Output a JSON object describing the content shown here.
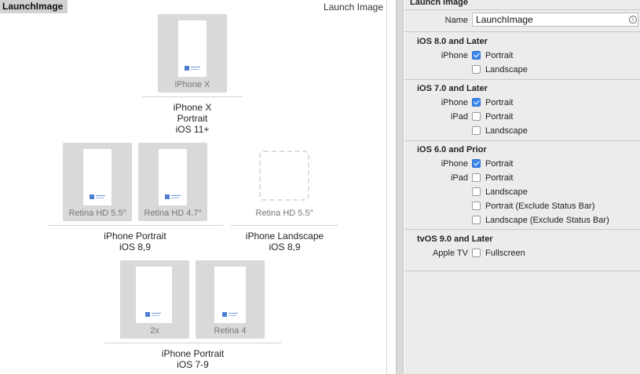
{
  "canvas": {
    "set_name": "LaunchImage",
    "set_type": "Launch Image",
    "groups": [
      {
        "caption": [
          "iPhone X",
          "Portrait",
          "iOS 11+"
        ],
        "slots": [
          {
            "label": "iPhone X",
            "filled": true
          }
        ]
      },
      {
        "caption": [
          "iPhone Portrait",
          "iOS 8,9"
        ],
        "slots": [
          {
            "label": "Retina HD 5.5″",
            "filled": true
          },
          {
            "label": "Retina HD 4.7″",
            "filled": true
          }
        ]
      },
      {
        "caption": [
          "iPhone Landscape",
          "iOS 8,9"
        ],
        "slots": [
          {
            "label": "Retina HD 5.5″",
            "filled": false
          }
        ]
      },
      {
        "caption": [
          "iPhone Portrait",
          "iOS 7-9"
        ],
        "slots": [
          {
            "label": "2x",
            "filled": true
          },
          {
            "label": "Retina 4",
            "filled": true
          }
        ]
      }
    ]
  },
  "inspector": {
    "header": "Launch Image",
    "name_label": "Name",
    "name_value": "LaunchImage",
    "sections": [
      {
        "title": "iOS 8.0 and Later",
        "rows": [
          {
            "device": "iPhone",
            "option": "Portrait",
            "checked": true
          },
          {
            "device": "",
            "option": "Landscape",
            "checked": false
          }
        ]
      },
      {
        "title": "iOS 7.0 and Later",
        "rows": [
          {
            "device": "iPhone",
            "option": "Portrait",
            "checked": true
          },
          {
            "device": "iPad",
            "option": "Portrait",
            "checked": false
          },
          {
            "device": "",
            "option": "Landscape",
            "checked": false
          }
        ]
      },
      {
        "title": "iOS 6.0 and Prior",
        "rows": [
          {
            "device": "iPhone",
            "option": "Portrait",
            "checked": true
          },
          {
            "device": "iPad",
            "option": "Portrait",
            "checked": false
          },
          {
            "device": "",
            "option": "Landscape",
            "checked": false
          },
          {
            "device": "",
            "option": "Portrait (Exclude Status Bar)",
            "checked": false
          },
          {
            "device": "",
            "option": "Landscape (Exclude Status Bar)",
            "checked": false
          }
        ]
      },
      {
        "title": "tvOS 9.0 and Later",
        "rows": [
          {
            "device": "Apple TV",
            "option": "Fullscreen",
            "checked": false
          }
        ]
      }
    ]
  },
  "colors": {
    "checked": "#3b87ec",
    "panel_bg": "#ececec",
    "slot_bg": "#d9d9d9"
  },
  "icons": {
    "name_field_action": "arrow-circle-icon"
  }
}
